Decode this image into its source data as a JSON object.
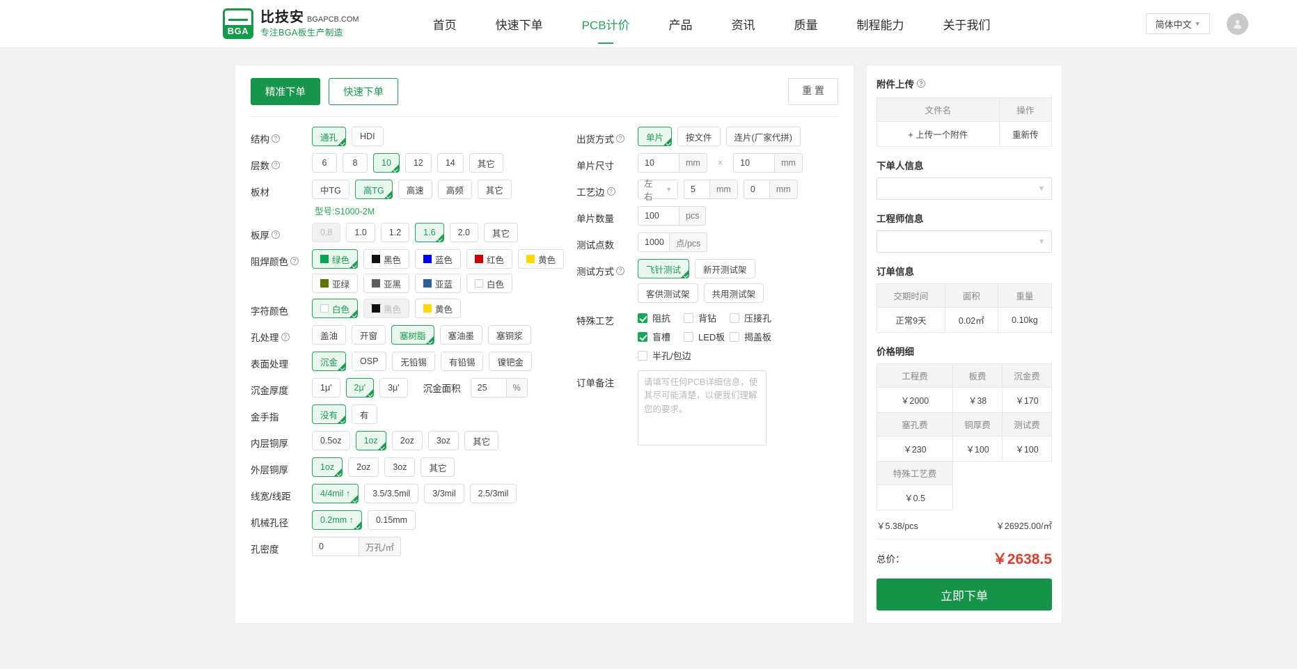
{
  "header": {
    "logo": {
      "brand_cn": "比技安",
      "brand_en": "BGAPCB.COM",
      "tagline": "专注BGA板生产制造",
      "mark_text": "BGA"
    },
    "nav": [
      {
        "label": "首页",
        "active": false
      },
      {
        "label": "快速下单",
        "active": false
      },
      {
        "label": "PCB计价",
        "active": true
      },
      {
        "label": "产品",
        "active": false
      },
      {
        "label": "资讯",
        "active": false
      },
      {
        "label": "质量",
        "active": false
      },
      {
        "label": "制程能力",
        "active": false
      },
      {
        "label": "关于我们",
        "active": false
      }
    ],
    "language": "简体中文",
    "accent": "#21a757"
  },
  "tabs": {
    "precise": "精准下单",
    "quick": "快速下单",
    "reset": "重 置"
  },
  "left_form": {
    "structure": {
      "label": "结构",
      "options": [
        "通孔",
        "HDI"
      ],
      "selected": "通孔"
    },
    "layers": {
      "label": "层数",
      "options": [
        "6",
        "8",
        "10",
        "12",
        "14",
        "其它"
      ],
      "selected": "10"
    },
    "material": {
      "label": "板材",
      "options": [
        "中TG",
        "高TG",
        "高速",
        "高频",
        "其它"
      ],
      "selected": "高TG",
      "note": "型号:S1000-2M"
    },
    "thickness": {
      "label": "板厚",
      "options": [
        "0.8",
        "1.0",
        "1.2",
        "1.6",
        "2.0",
        "其它"
      ],
      "selected": "1.6",
      "disabled": [
        "0.8"
      ]
    },
    "solder_mask": {
      "label": "阻焊颜色",
      "options": [
        {
          "text": "绿色",
          "color": "#00a650"
        },
        {
          "text": "黑色",
          "color": "#111111"
        },
        {
          "text": "蓝色",
          "color": "#0000ee"
        },
        {
          "text": "红色",
          "color": "#cc0000"
        },
        {
          "text": "黄色",
          "color": "#ffd900"
        },
        {
          "text": "亚绿",
          "color": "#5c7500"
        },
        {
          "text": "亚黑",
          "color": "#5e5e5e"
        },
        {
          "text": "亚蓝",
          "color": "#2e6099"
        },
        {
          "text": "白色",
          "color": "#ffffff"
        }
      ],
      "selected": "绿色"
    },
    "silkscreen": {
      "label": "字符颜色",
      "options": [
        {
          "text": "白色",
          "color": "#ffffff"
        },
        {
          "text": "黑色",
          "color": "#111111"
        },
        {
          "text": "黄色",
          "color": "#ffd900"
        }
      ],
      "selected": "白色",
      "disabled": [
        "黑色"
      ]
    },
    "via_process": {
      "label": "孔处理",
      "options": [
        "盖油",
        "开窗",
        "塞树脂",
        "塞油墨",
        "塞铜浆"
      ],
      "selected": "塞树脂"
    },
    "surface_finish": {
      "label": "表面处理",
      "options": [
        "沉金",
        "OSP",
        "无铅锡",
        "有铅锡",
        "镍钯金"
      ],
      "selected": "沉金"
    },
    "gold_thickness": {
      "label": "沉金厚度",
      "options": [
        "1μ'",
        "2μ'",
        "3μ'"
      ],
      "selected": "2μ'",
      "area_label": "沉金面积",
      "area_value": "25",
      "area_unit": "%"
    },
    "gold_finger": {
      "label": "金手指",
      "options": [
        "没有",
        "有"
      ],
      "selected": "没有"
    },
    "inner_copper": {
      "label": "内层铜厚",
      "options": [
        "0.5oz",
        "1oz",
        "2oz",
        "3oz",
        "其它"
      ],
      "selected": "1oz"
    },
    "outer_copper": {
      "label": "外层铜厚",
      "options": [
        "1oz",
        "2oz",
        "3oz",
        "其它"
      ],
      "selected": "1oz"
    },
    "trace": {
      "label": "线宽/线距",
      "options": [
        "4/4mil ↑",
        "3.5/3.5mil",
        "3/3mil",
        "2.5/3mil"
      ],
      "selected": "4/4mil ↑"
    },
    "drill": {
      "label": "机械孔径",
      "options": [
        "0.2mm ↑",
        "0.15mm"
      ],
      "selected": "0.2mm ↑"
    },
    "hole_density": {
      "label": "孔密度",
      "value": "0",
      "unit": "万孔/㎡"
    }
  },
  "right_form": {
    "delivery": {
      "label": "出货方式",
      "options": [
        "单片",
        "按文件",
        "连片(厂家代拼)"
      ],
      "selected": "单片"
    },
    "size": {
      "label": "单片尺寸",
      "width": "10",
      "height": "10",
      "unit": "mm",
      "sep": "×"
    },
    "panel_edge": {
      "label": "工艺边",
      "side": "左右",
      "v1": "5",
      "v2": "0",
      "unit": "mm"
    },
    "quantity": {
      "label": "单片数量",
      "value": "100",
      "unit": "pcs"
    },
    "test_points": {
      "label": "测试点数",
      "value": "1000",
      "unit": "点/pcs"
    },
    "test_method": {
      "label": "测试方式",
      "options": [
        "飞针测试",
        "新开测试架",
        "客供测试架",
        "共用测试架"
      ],
      "selected": "飞针测试"
    },
    "special": {
      "label": "特殊工艺",
      "items": [
        {
          "text": "阻抗",
          "checked": true
        },
        {
          "text": "背钻",
          "checked": false
        },
        {
          "text": "压接孔",
          "checked": false
        },
        {
          "text": "盲槽",
          "checked": true
        },
        {
          "text": "LED板",
          "checked": false
        },
        {
          "text": "揭盖板",
          "checked": false
        },
        {
          "text": "半孔/包边",
          "checked": false
        }
      ]
    },
    "remark": {
      "label": "订单备注",
      "placeholder": "请填写任何PCB详细信息，使其尽可能清楚，以便我们理解您的要求。",
      "value": ""
    }
  },
  "sidebar": {
    "attachment": {
      "title": "附件上传",
      "headers": [
        "文件名",
        "操作"
      ],
      "upload_text": "+ 上传一个附件",
      "reupload_text": "重新传"
    },
    "orderer": {
      "title": "下单人信息",
      "value": ""
    },
    "engineer": {
      "title": "工程师信息",
      "value": ""
    },
    "order_info": {
      "title": "订单信息",
      "headers": [
        "交期时间",
        "面积",
        "重量"
      ],
      "values": [
        "正常9天",
        "0.02㎡",
        "0.10kg"
      ]
    },
    "price_detail": {
      "title": "价格明细",
      "rows": [
        {
          "headers": [
            "工程费",
            "板费",
            "沉金费"
          ],
          "values": [
            "￥2000",
            "￥38",
            "￥170"
          ]
        },
        {
          "headers": [
            "塞孔费",
            "铜厚费",
            "测试费"
          ],
          "values": [
            "￥230",
            "￥100",
            "￥100"
          ]
        },
        {
          "headers": [
            "特殊工艺费",
            "",
            ""
          ],
          "values": [
            "￥0.5",
            "",
            ""
          ]
        }
      ]
    },
    "unit_price": "￥5.38/pcs",
    "area_price": "￥26925.00/㎡",
    "total_label": "总价：",
    "total_value": "￥2638.5",
    "order_button": "立即下单"
  }
}
